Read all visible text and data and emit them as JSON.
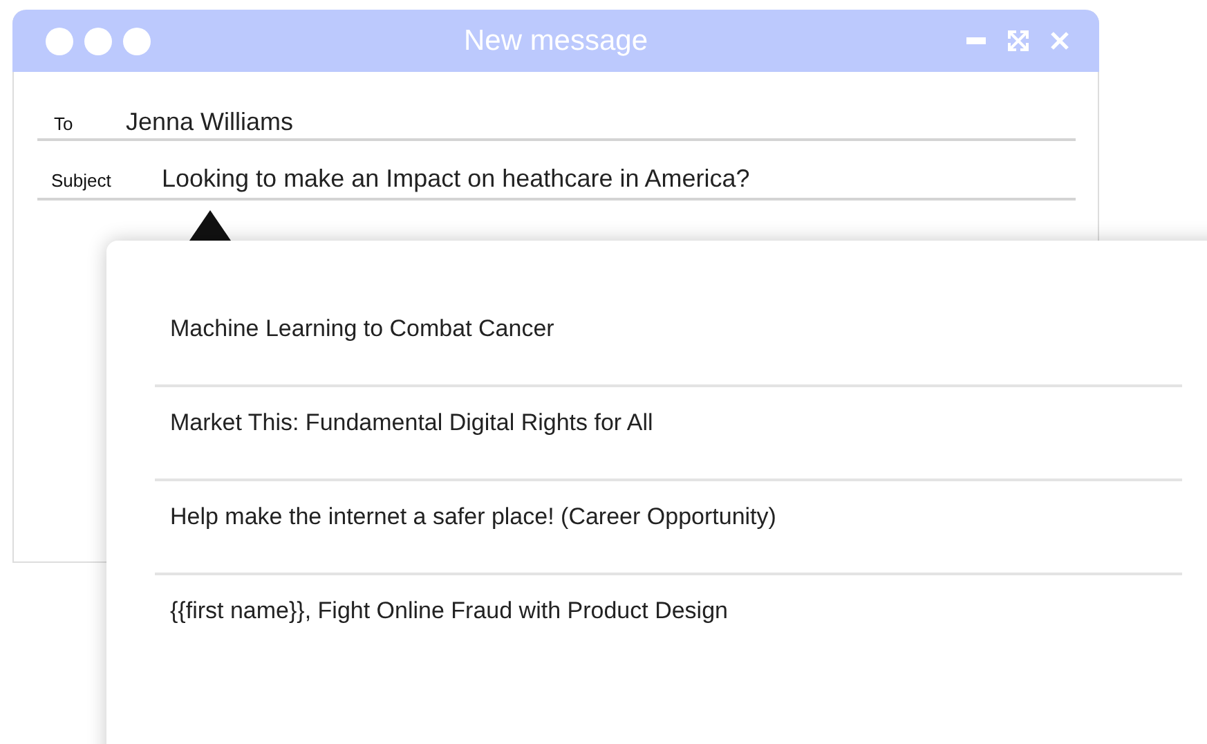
{
  "window": {
    "title": "New message"
  },
  "fields": [
    {
      "label": "To",
      "value": "Jenna Williams"
    },
    {
      "label": "Subject",
      "value": "Looking to make an Impact on heathcare in America?"
    }
  ],
  "suggestions": [
    "Machine Learning to Combat Cancer",
    "Market This: Fundamental Digital Rights for All",
    "Help make the internet a safer place! (Career Opportunity)",
    "{{first name}}, Fight Online Fraud with Product Design"
  ]
}
